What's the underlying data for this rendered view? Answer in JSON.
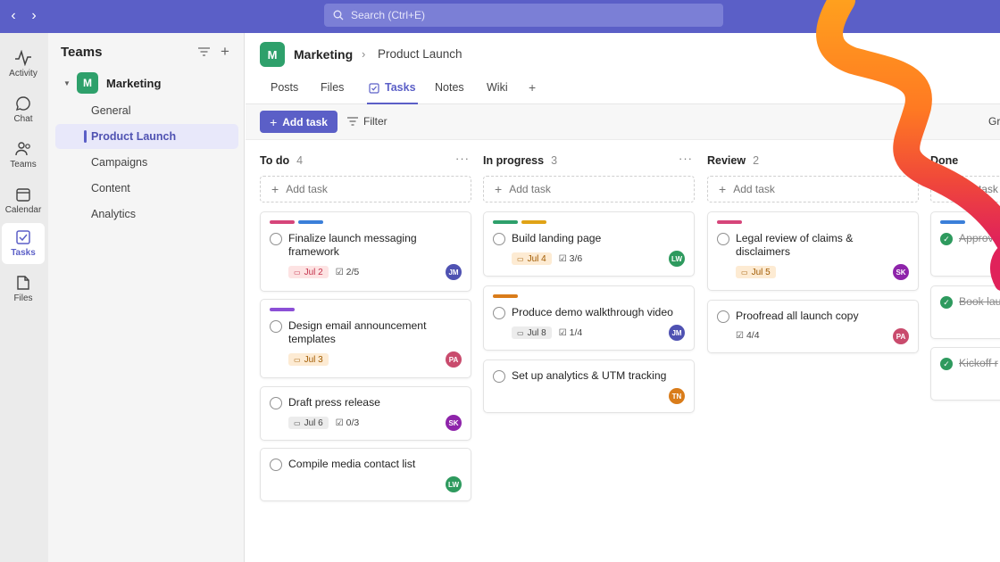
{
  "search": {
    "placeholder": "Search (Ctrl+E)"
  },
  "rail": [
    {
      "label": "Activity",
      "icon": "activity-icon"
    },
    {
      "label": "Chat",
      "icon": "chat-icon"
    },
    {
      "label": "Teams",
      "icon": "teams-icon"
    },
    {
      "label": "Calendar",
      "icon": "calendar-icon"
    },
    {
      "label": "Tasks",
      "icon": "tasks-icon",
      "active": true
    },
    {
      "label": "Files",
      "icon": "files-icon"
    }
  ],
  "teams_pane": {
    "title": "Teams",
    "team": {
      "initial": "M",
      "name": "Marketing"
    },
    "channels": [
      "General",
      "Product Launch",
      "Campaigns",
      "Content",
      "Analytics"
    ],
    "active_channel": "Product Launch"
  },
  "header": {
    "team_initial": "M",
    "team": "Marketing",
    "separator": "›",
    "channel": "Product Launch",
    "tabs": [
      "Posts",
      "Files",
      "Tasks",
      "Notes",
      "Wiki"
    ],
    "active_tab": "Tasks",
    "add_tab": "+"
  },
  "toolbar": {
    "add_task": "Add task",
    "filter": "Filter",
    "group": "Gr"
  },
  "colors": {
    "brand": "#5b5fc7",
    "tag_pink": "#d6457a",
    "tag_blue": "#3b7fd9",
    "tag_purple": "#8b4fd6",
    "tag_green": "#2ea06b",
    "tag_yellow": "#e0a316",
    "tag_orange": "#d97c1a"
  },
  "columns": [
    {
      "title": "To do",
      "count": "4",
      "add": "Add task",
      "cards": [
        {
          "title": "Finalize launch messaging framework",
          "tags": [
            "tag_pink",
            "tag_blue"
          ],
          "date": "Jul 2",
          "date_style": "red",
          "subtasks": "2/5",
          "assignee": "JM",
          "assignee_color": "#4f52b2"
        },
        {
          "title": "Design email announcement templates",
          "tags": [
            "tag_purple"
          ],
          "date": "Jul 3",
          "date_style": "orange",
          "subtasks": "",
          "assignee": "PA",
          "assignee_color": "#c94b6d"
        },
        {
          "title": "Draft press release",
          "tags": [],
          "date": "Jul 6",
          "date_style": "gray",
          "subtasks": "0/3",
          "assignee": "SK",
          "assignee_color": "#8e24aa"
        },
        {
          "title": "Compile media contact list",
          "tags": [],
          "date": "",
          "date_style": "",
          "subtasks": "",
          "assignee": "LW",
          "assignee_color": "#2e9a5e"
        }
      ]
    },
    {
      "title": "In progress",
      "count": "3",
      "add": "Add task",
      "cards": [
        {
          "title": "Build landing page",
          "tags": [
            "tag_green",
            "tag_yellow"
          ],
          "date": "Jul 4",
          "date_style": "orange",
          "subtasks": "3/6",
          "assignee": "LW",
          "assignee_color": "#2e9a5e"
        },
        {
          "title": "Produce demo walkthrough video",
          "tags": [
            "tag_orange"
          ],
          "date": "Jul 8",
          "date_style": "gray",
          "subtasks": "1/4",
          "assignee": "JM",
          "assignee_color": "#4f52b2"
        },
        {
          "title": "Set up analytics & UTM tracking",
          "tags": [],
          "date": "",
          "date_style": "",
          "subtasks": "",
          "assignee": "TN",
          "assignee_color": "#d97c1a"
        }
      ]
    },
    {
      "title": "Review",
      "count": "2",
      "add": "Add task",
      "cards": [
        {
          "title": "Legal review of claims & disclaimers",
          "tags": [
            "tag_pink"
          ],
          "date": "Jul 5",
          "date_style": "orange",
          "subtasks": "",
          "assignee": "SK",
          "assignee_color": "#8e24aa"
        },
        {
          "title": "Proofread all launch copy",
          "tags": [],
          "date": "",
          "date_style": "",
          "subtasks": "4/4",
          "assignee": "PA",
          "assignee_color": "#c94b6d"
        }
      ]
    },
    {
      "title": "Done",
      "count": "",
      "add": "Add task",
      "cards": [
        {
          "title": "Approve",
          "tags": [
            "tag_blue"
          ],
          "done": true
        },
        {
          "title": "Book lau",
          "tags": [],
          "done": true
        },
        {
          "title": "Kickoff r",
          "tags": [],
          "done": true
        }
      ]
    }
  ]
}
